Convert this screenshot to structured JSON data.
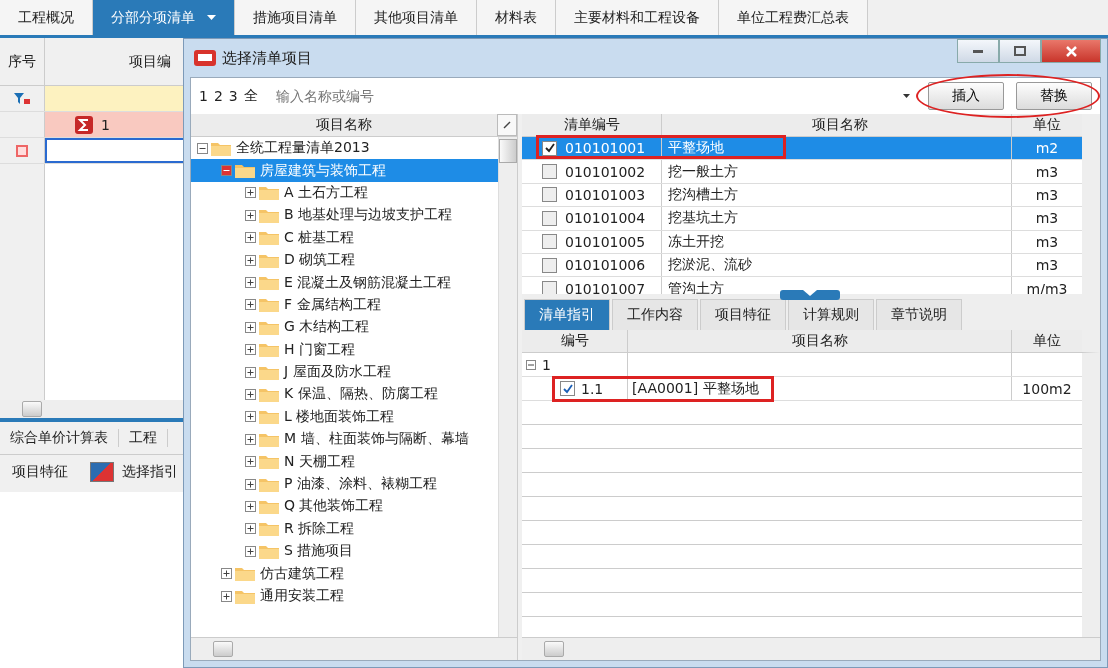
{
  "main_tabs": [
    {
      "label": "工程概况",
      "selected": false
    },
    {
      "label": "分部分项清单",
      "selected": true
    },
    {
      "label": "措施项目清单",
      "selected": false
    },
    {
      "label": "其他项目清单",
      "selected": false
    },
    {
      "label": "材料表",
      "selected": false
    },
    {
      "label": "主要材料和工程设备",
      "selected": false
    },
    {
      "label": "单位工程费汇总表",
      "selected": false
    }
  ],
  "main_grid": {
    "columns": [
      "序号",
      "项目编"
    ],
    "rows": [
      {
        "number": "1"
      }
    ]
  },
  "bottom_panel": {
    "tabs": [
      "综合单价计算表",
      "工程"
    ],
    "toolbar": [
      "项目特征",
      "选择指引"
    ]
  },
  "dialog": {
    "title": "选择清单项目",
    "level_buttons": [
      "1",
      "2",
      "3",
      "全"
    ],
    "search": {
      "placeholder": "输入名称或编号"
    },
    "buttons": [
      "插入",
      "替换"
    ],
    "tree": {
      "header": "项目名称",
      "items": [
        {
          "label": "全统工程量清单2013",
          "expanded": true,
          "selected": false,
          "children": [
            {
              "label": "房屋建筑与装饰工程",
              "expanded": true,
              "selected": true,
              "children": [
                {
                  "label": "A 土石方工程",
                  "expanded": false,
                  "selected": false
                },
                {
                  "label": "B 地基处理与边坡支护工程",
                  "expanded": false,
                  "selected": false
                },
                {
                  "label": "C 桩基工程",
                  "expanded": false,
                  "selected": false
                },
                {
                  "label": "D 砌筑工程",
                  "expanded": false,
                  "selected": false
                },
                {
                  "label": "E 混凝土及钢筋混凝土工程",
                  "expanded": false,
                  "selected": false
                },
                {
                  "label": "F 金属结构工程",
                  "expanded": false,
                  "selected": false
                },
                {
                  "label": "G 木结构工程",
                  "expanded": false,
                  "selected": false
                },
                {
                  "label": "H 门窗工程",
                  "expanded": false,
                  "selected": false
                },
                {
                  "label": "J 屋面及防水工程",
                  "expanded": false,
                  "selected": false
                },
                {
                  "label": "K 保温、隔热、防腐工程",
                  "expanded": false,
                  "selected": false
                },
                {
                  "label": "L 楼地面装饰工程",
                  "expanded": false,
                  "selected": false
                },
                {
                  "label": "M 墙、柱面装饰与隔断、幕墙",
                  "expanded": false,
                  "selected": false
                },
                {
                  "label": "N 天棚工程",
                  "expanded": false,
                  "selected": false
                },
                {
                  "label": "P 油漆、涂料、裱糊工程",
                  "expanded": false,
                  "selected": false
                },
                {
                  "label": "Q 其他装饰工程",
                  "expanded": false,
                  "selected": false
                },
                {
                  "label": "R 拆除工程",
                  "expanded": false,
                  "selected": false
                },
                {
                  "label": "S 措施项目",
                  "expanded": false,
                  "selected": false
                }
              ]
            },
            {
              "label": "仿古建筑工程",
              "expanded": false,
              "selected": false
            },
            {
              "label": "通用安装工程",
              "expanded": false,
              "selected": false
            }
          ]
        }
      ]
    }
  },
  "list": {
    "columns": [
      "清单编号",
      "项目名称",
      "单位"
    ],
    "rows": [
      {
        "code": "010101001",
        "name": "平整场地",
        "unit": "m2",
        "checked": true,
        "selected": true
      },
      {
        "code": "010101002",
        "name": "挖一般土方",
        "unit": "m3",
        "checked": false,
        "selected": false
      },
      {
        "code": "010101003",
        "name": "挖沟槽土方",
        "unit": "m3",
        "checked": false,
        "selected": false
      },
      {
        "code": "010101004",
        "name": "挖基坑土方",
        "unit": "m3",
        "checked": false,
        "selected": false
      },
      {
        "code": "010101005",
        "name": "冻土开挖",
        "unit": "m3",
        "checked": false,
        "selected": false
      },
      {
        "code": "010101006",
        "name": "挖淤泥、流砂",
        "unit": "m3",
        "checked": false,
        "selected": false
      },
      {
        "code": "010101007",
        "name": "管沟土方",
        "unit": "m/m3",
        "checked": false,
        "selected": false
      }
    ]
  },
  "detail_tabs": [
    {
      "label": "清单指引",
      "selected": true
    },
    {
      "label": "工作内容",
      "selected": false
    },
    {
      "label": "项目特征",
      "selected": false
    },
    {
      "label": "计算规则",
      "selected": false
    },
    {
      "label": "章节说明",
      "selected": false
    }
  ],
  "guide": {
    "columns": [
      "编号",
      "项目名称",
      "单位"
    ],
    "rows": [
      {
        "number": "1",
        "expanded": true,
        "children": [
          {
            "number": "1.1",
            "name": "[AA0001] 平整场地",
            "unit": "100m2",
            "checked": true
          }
        ]
      }
    ]
  }
}
